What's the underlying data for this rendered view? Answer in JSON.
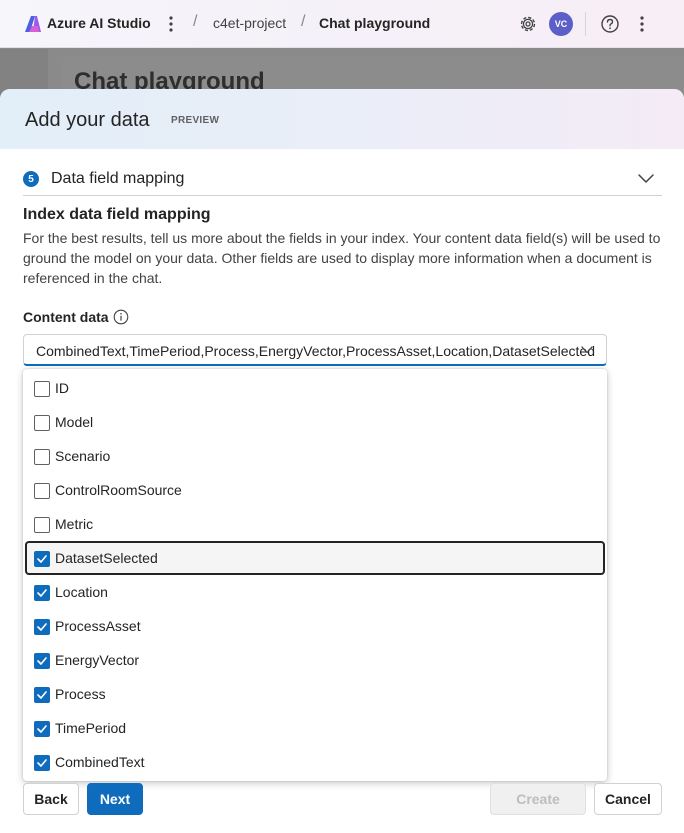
{
  "topbar": {
    "brand": "Azure AI Studio",
    "project": "c4et-project",
    "page": "Chat playground",
    "avatar_initials": "VC",
    "icons": [
      "azure-ai-logo-icon",
      "more-vertical-icon",
      "settings-gear-icon",
      "help-icon",
      "more-vertical-icon"
    ]
  },
  "background_page": {
    "title": "Chat playground"
  },
  "dialog": {
    "title": "Add your data",
    "badge": "PREVIEW",
    "step": {
      "number": "5",
      "title": "Data field mapping"
    },
    "section_title": "Index data field mapping",
    "description": "For the best results, tell us more about the fields in your index. Your content data field(s) will be used to ground the model on your data. Other fields are used to display more information when a document is referenced in the chat.",
    "content_data": {
      "label": "Content data",
      "selected_value": "CombinedText,TimePeriod,Process,EnergyVector,ProcessAsset,Location,DatasetSelected",
      "options": [
        {
          "label": "ID",
          "checked": false
        },
        {
          "label": "Model",
          "checked": false
        },
        {
          "label": "Scenario",
          "checked": false
        },
        {
          "label": "ControlRoomSource",
          "checked": false
        },
        {
          "label": "Metric",
          "checked": false
        },
        {
          "label": "DatasetSelected",
          "checked": true,
          "focused": true
        },
        {
          "label": "Location",
          "checked": true
        },
        {
          "label": "ProcessAsset",
          "checked": true
        },
        {
          "label": "EnergyVector",
          "checked": true
        },
        {
          "label": "Process",
          "checked": true
        },
        {
          "label": "TimePeriod",
          "checked": true
        },
        {
          "label": "CombinedText",
          "checked": true
        }
      ]
    },
    "footer": {
      "back_label": "Back",
      "next_label": "Next",
      "create_label": "Create",
      "cancel_label": "Cancel"
    }
  },
  "colors": {
    "accent": "#0f6cbd",
    "avatar": "#5b5fc7"
  }
}
